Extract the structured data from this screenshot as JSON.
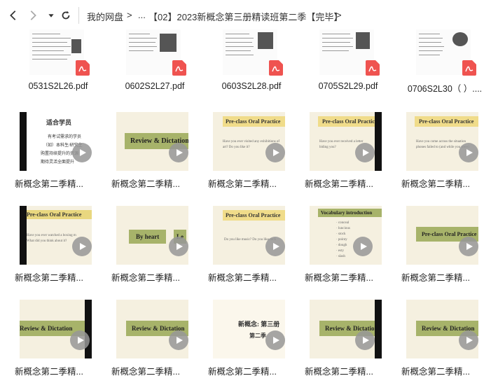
{
  "toolbar": {
    "back_icon": "chevron-left-icon",
    "forward_icon": "chevron-right-icon",
    "history_icon": "caret-down-icon",
    "refresh_icon": "refresh-icon",
    "breadcrumb": [
      "我的网盘",
      "...",
      "【02】2023新概念第三册精读班第二季【完毕】"
    ]
  },
  "pdf_files": [
    {
      "name": "0531S2L26.pdf"
    },
    {
      "name": "0602S2L27.pdf"
    },
    {
      "name": "0603S2L28.pdf"
    },
    {
      "name": "0705S2L29.pdf"
    },
    {
      "name": "0706S2L30（ ）...."
    }
  ],
  "videos": [
    {
      "name": "新概念第二季精...",
      "slide": "适合学员",
      "lines": [
        "有考试需求的学员",
        "（如）本科生/研究生",
        "购置持续提升的资源",
        "期待灵活全面提升"
      ]
    },
    {
      "name": "新概念第二季精...",
      "slide": "Review & Dictation"
    },
    {
      "name": "新概念第二季精...",
      "slide": "Pre-class Oral Practice",
      "lines": [
        "Have you ever visited any exhibitions of",
        "art? Do you like it?"
      ]
    },
    {
      "name": "新概念第二季精...",
      "slide": "Pre-class Oral Practice",
      "lines": [
        "Have you ever received a letter",
        "biding you?"
      ]
    },
    {
      "name": "新概念第二季精...",
      "slide": "Pre-class Oral Practice",
      "lines": [
        "Have you come across the situation",
        "phones failed to (and while you were)"
      ]
    },
    {
      "name": "新概念第二季精...",
      "slide": "Pre-class Oral Practice",
      "lines": [
        "Have you ever watched a boxing m",
        "What did you think about it?"
      ]
    },
    {
      "name": "新概念第二季精...",
      "slide": "By heart",
      "slide2": "Le"
    },
    {
      "name": "新概念第二季精...",
      "slide": "Pre-class Oral Practice",
      "lines": [
        "Do you like music? Do you like rock"
      ]
    },
    {
      "name": "新概念第二季精...",
      "slide": "Vocabulary introduction",
      "lines": [
        "·  conceal",
        "·  luncious",
        "·  stock",
        "·  pointy",
        "·  dough",
        "·  esty",
        "·  slash"
      ]
    },
    {
      "name": "新概念第二季精...",
      "slide": "Pre-class Oral Practice"
    },
    {
      "name": "新概念第二季精...",
      "slide": "Review & Dictation"
    },
    {
      "name": "新概念第二季精...",
      "slide": "Review & Dictation"
    },
    {
      "name": "新概念第二季精...",
      "slide": "新概念: 第三册",
      "lines": [
        "第二季"
      ]
    },
    {
      "name": "新概念第二季精...",
      "slide": "Review & Dictation"
    },
    {
      "name": "新概念第二季精...",
      "slide": "Review & Dictation"
    }
  ],
  "colors": {
    "pdf_badge": "#ef5350",
    "olive_title": "#a7b36a",
    "slide_bg": "#f5f0e0",
    "play_button": "#969696"
  }
}
